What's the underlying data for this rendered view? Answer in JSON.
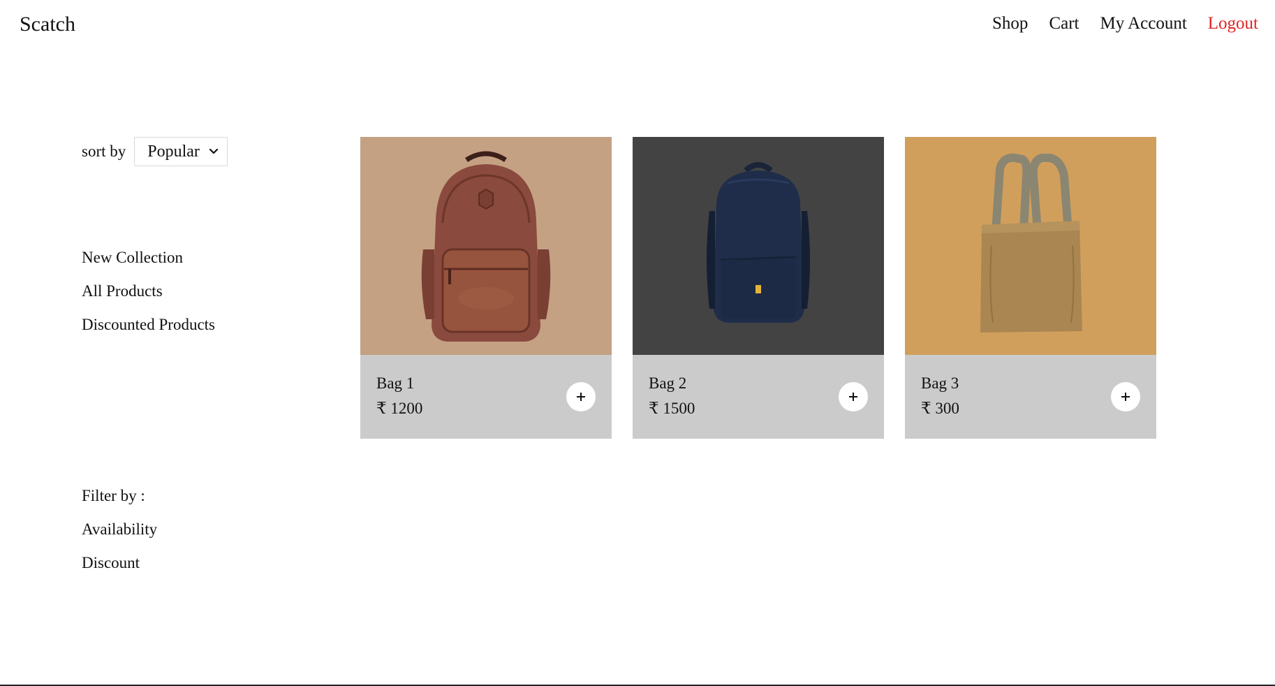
{
  "nav": {
    "brand": "Scatch",
    "links": [
      "Shop",
      "Cart",
      "My Account",
      "Logout"
    ]
  },
  "sidebar": {
    "sort_label": "sort by",
    "sort_selected": "Popular",
    "collections": [
      "New Collection",
      "All Products",
      "Discounted Products"
    ],
    "filter_title": "Filter by :",
    "filters": [
      "Availability",
      "Discount"
    ]
  },
  "products": [
    {
      "name": "Bag 1",
      "price": "₹ 1200",
      "bg": "#c4a183"
    },
    {
      "name": "Bag 2",
      "price": "₹ 1500",
      "bg": "#434343"
    },
    {
      "name": "Bag 3",
      "price": "₹ 300",
      "bg": "#d19f5c"
    }
  ],
  "icons": {
    "add": "plus-icon",
    "dropdown": "chevron-down-icon"
  }
}
